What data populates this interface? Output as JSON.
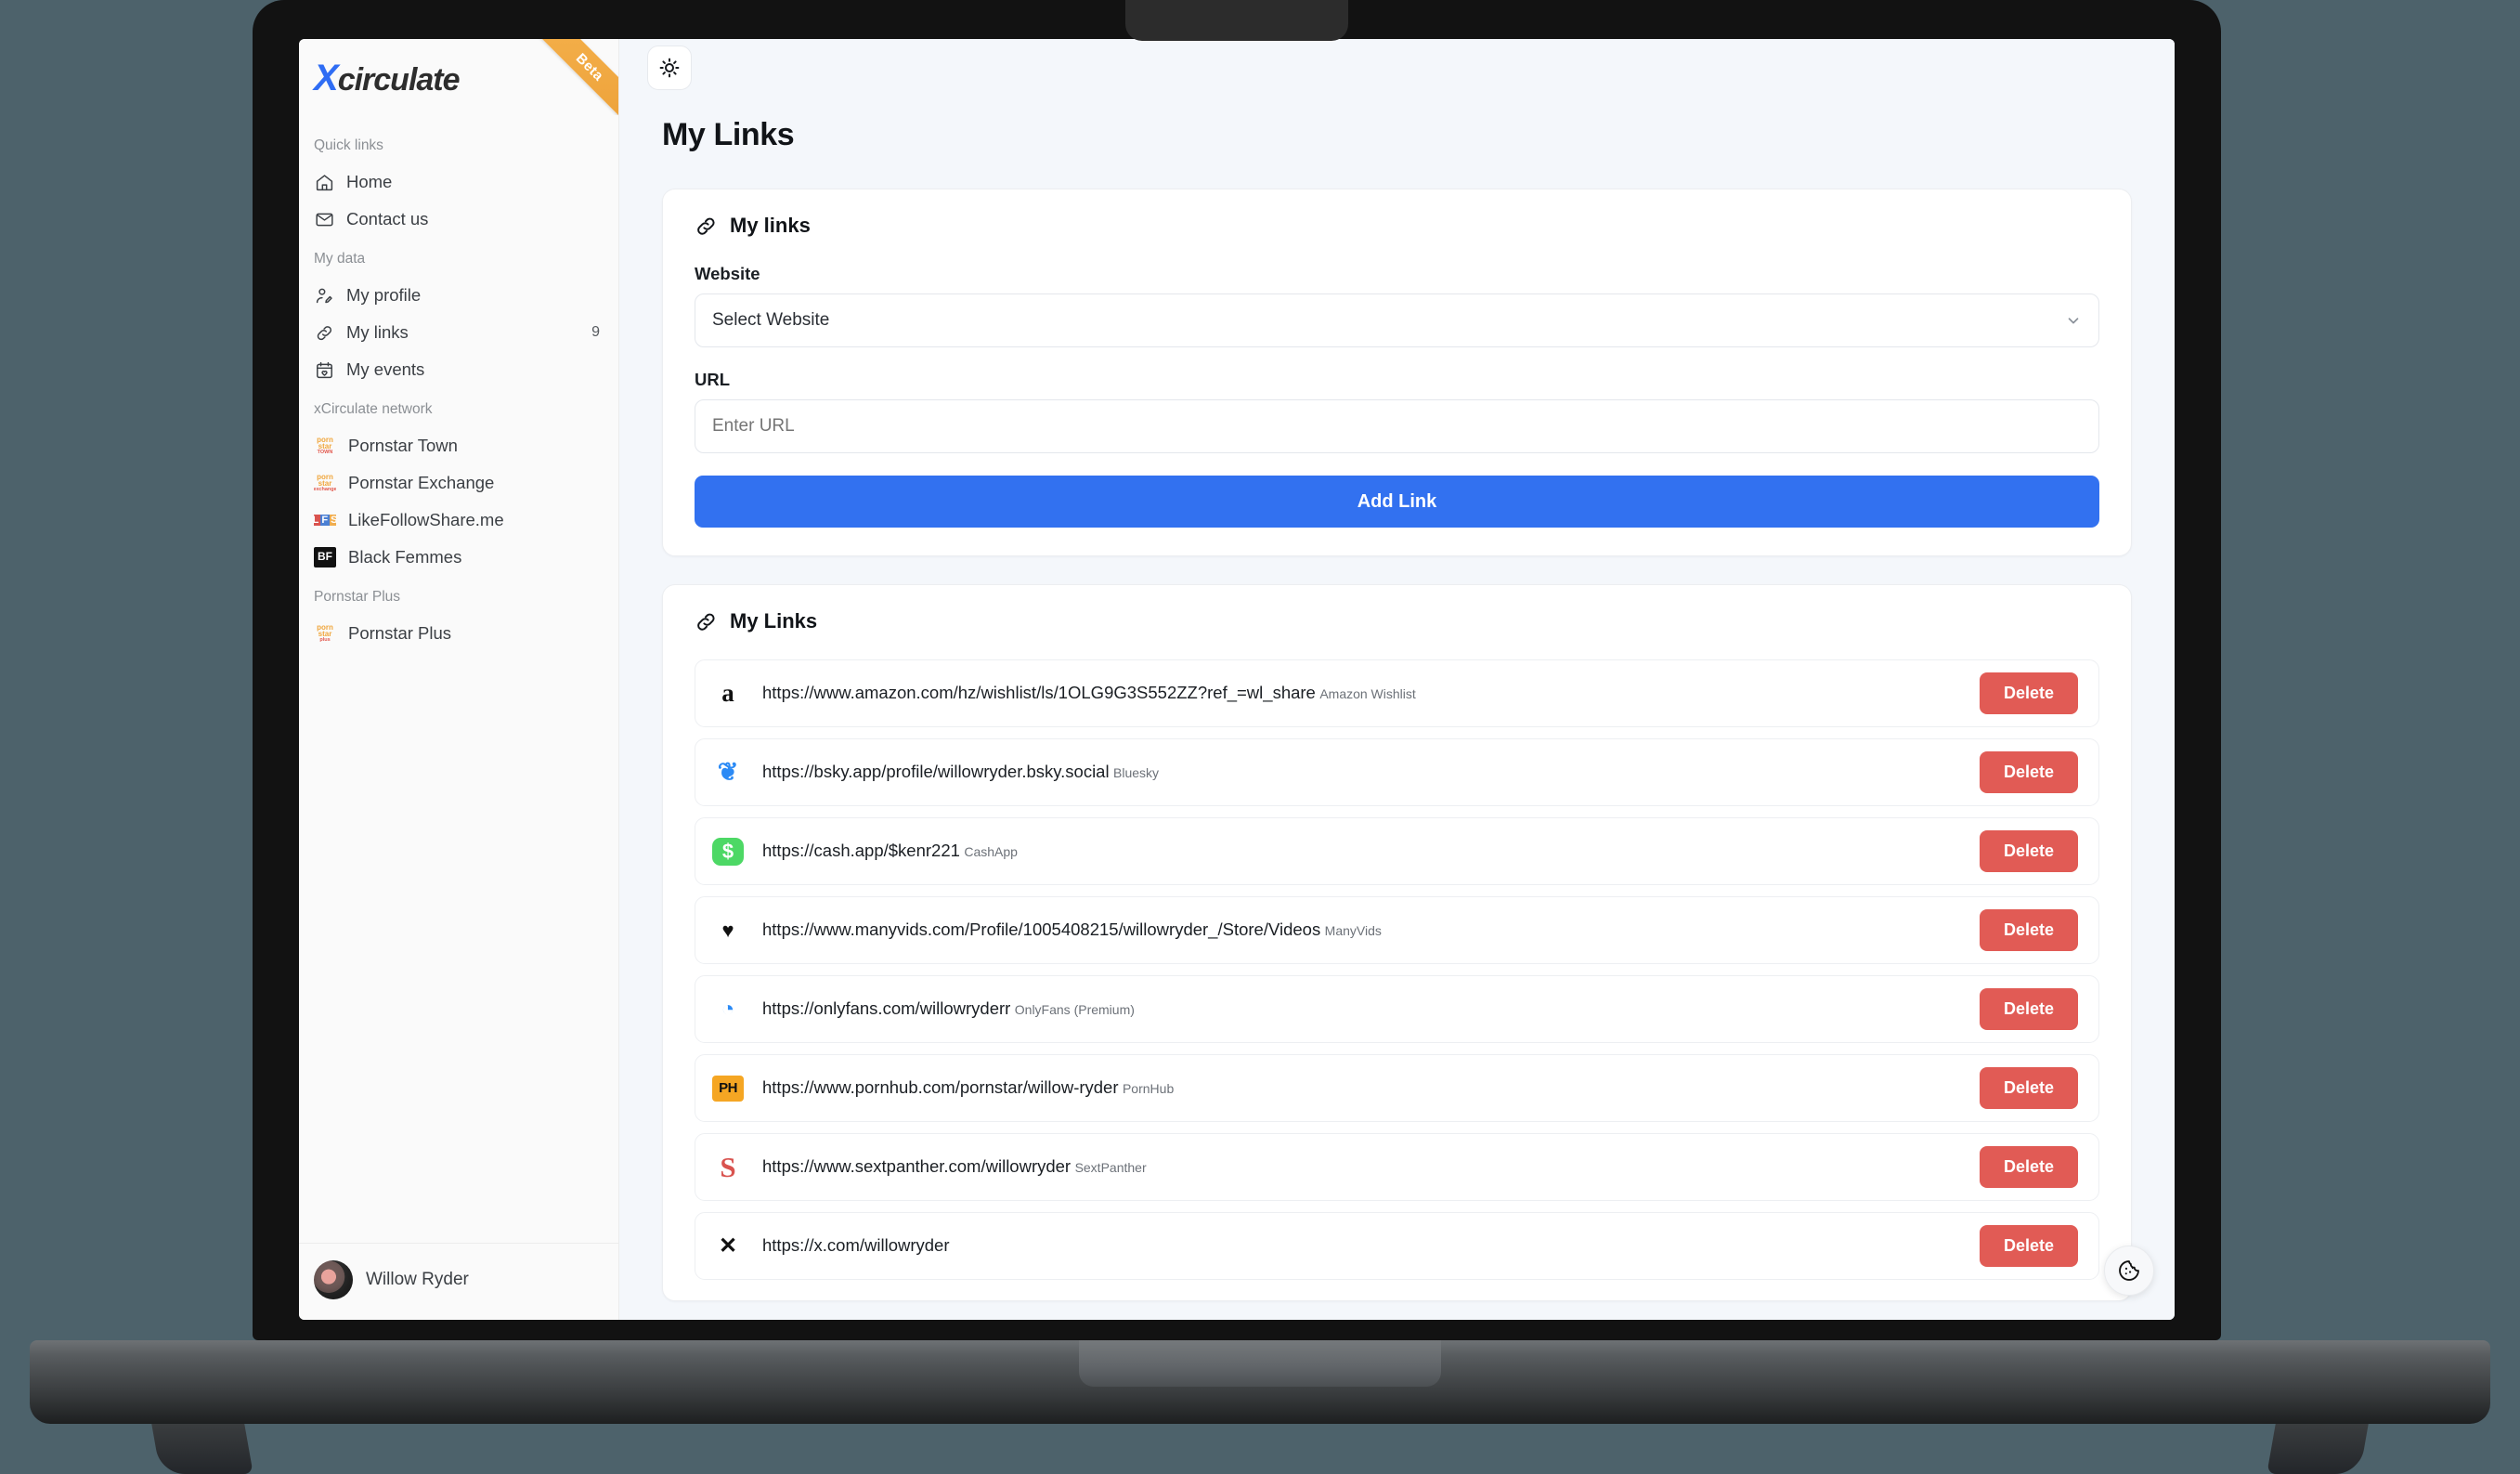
{
  "sidebar": {
    "brand": {
      "x": "X",
      "rest": "circulate"
    },
    "beta_badge": "Beta",
    "sections": [
      {
        "title": "Quick links",
        "items": [
          {
            "label": "Home",
            "icon": "home-icon",
            "count": ""
          },
          {
            "label": "Contact us",
            "icon": "mail-icon",
            "count": ""
          }
        ]
      },
      {
        "title": "My data",
        "items": [
          {
            "label": "My profile",
            "icon": "user-edit-icon",
            "count": ""
          },
          {
            "label": "My links",
            "icon": "link-icon",
            "count": "9"
          },
          {
            "label": "My events",
            "icon": "calendar-heart-icon",
            "count": ""
          }
        ]
      },
      {
        "title": "xCirculate network",
        "items": [
          {
            "label": "Pornstar Town",
            "icon": "pornstar-town-logo",
            "count": ""
          },
          {
            "label": "Pornstar Exchange",
            "icon": "pornstar-exchange-logo",
            "count": ""
          },
          {
            "label": "LikeFollowShare.me",
            "icon": "likefollowshare-logo",
            "count": ""
          },
          {
            "label": "Black Femmes",
            "icon": "black-femmes-logo",
            "count": ""
          }
        ]
      },
      {
        "title": "Pornstar Plus",
        "items": [
          {
            "label": "Pornstar Plus",
            "icon": "pornstar-plus-logo",
            "count": ""
          }
        ]
      }
    ],
    "user": {
      "name": "Willow Ryder"
    }
  },
  "topbar": {
    "theme_toggle": "sun-icon"
  },
  "page": {
    "title": "My Links"
  },
  "add_form": {
    "card_title": "My links",
    "website_label": "Website",
    "website_selected": "Select Website",
    "url_label": "URL",
    "url_placeholder": "Enter URL",
    "url_value": "",
    "submit_label": "Add Link"
  },
  "links_list": {
    "card_title": "My Links",
    "delete_label": "Delete",
    "items": [
      {
        "url": "https://www.amazon.com/hz/wishlist/ls/1OLG9G3S552ZZ?ref_=wl_share",
        "site": "Amazon Wishlist",
        "icon": "amazon-icon",
        "glyph": "a",
        "delete_label": "Delete"
      },
      {
        "url": "https://bsky.app/profile/willowryder.bsky.social",
        "site": "Bluesky",
        "icon": "bluesky-butterfly-icon",
        "glyph": "❦",
        "delete_label": "Delete"
      },
      {
        "url": "https://cash.app/$kenr221",
        "site": "CashApp",
        "icon": "cashapp-icon",
        "glyph": "$",
        "delete_label": "Delete"
      },
      {
        "url": "https://www.manyvids.com/Profile/1005408215/willowryder_/Store/Videos",
        "site": "ManyVids",
        "icon": "manyvids-icon",
        "glyph": "♥",
        "delete_label": "Delete"
      },
      {
        "url": "https://onlyfans.com/willowryderr",
        "site": "OnlyFans (Premium)",
        "icon": "onlyfans-icon",
        "glyph": "◔",
        "delete_label": "Delete"
      },
      {
        "url": "https://www.pornhub.com/pornstar/willow-ryder",
        "site": "PornHub",
        "icon": "pornhub-icon",
        "glyph": "PH",
        "delete_label": "Delete"
      },
      {
        "url": "https://www.sextpanther.com/willowryder",
        "site": "SextPanther",
        "icon": "sextpanther-icon",
        "glyph": "S",
        "delete_label": "Delete"
      },
      {
        "url": "https://x.com/willowryder",
        "site": "",
        "icon": "x-twitter-icon",
        "glyph": "✕",
        "delete_label": "Delete"
      }
    ]
  },
  "cookie_widget": {
    "icon": "cookie-icon"
  }
}
